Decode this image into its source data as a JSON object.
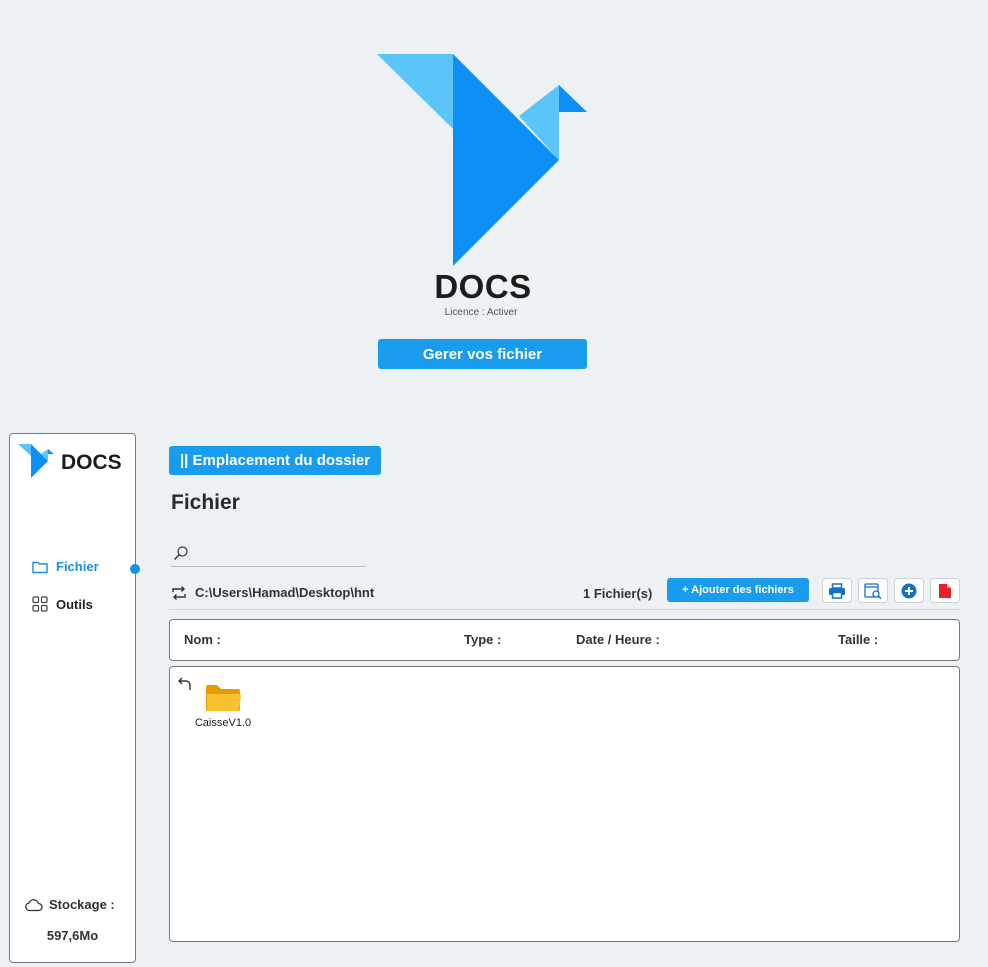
{
  "app": {
    "title": "DOCS",
    "licence": "Licence : Activer",
    "manage_button": "Gerer vos fichier"
  },
  "sidebar": {
    "title": "DOCS",
    "items": [
      {
        "label": "Fichier",
        "icon": "folder-icon",
        "active": true
      },
      {
        "label": "Outils",
        "icon": "grid-icon",
        "active": false
      }
    ],
    "storage_label": "Stockage :",
    "storage_value": "597,6Mo"
  },
  "main": {
    "location_button": "|| Emplacement du dossier",
    "section_title": "Fichier",
    "search": {
      "placeholder": "",
      "value": ""
    },
    "path": "C:\\Users\\Hamad\\Desktop\\hnt",
    "file_count": "1  Fichier(s)",
    "add_button": "+ Ajouter des fichiers",
    "toolbar": [
      "print-icon",
      "view-icon",
      "add-circle-icon",
      "pdf-icon"
    ],
    "columns": [
      "Nom :",
      "Type :",
      "Date / Heure :",
      "Taille :"
    ],
    "files": [
      {
        "name": "CaisseV1.0",
        "icon": "folder-icon"
      }
    ]
  },
  "colors": {
    "accent": "#1a9cee",
    "logo_dark": "#0e8ff5",
    "logo_light": "#5bc4f8",
    "folder": "#f7b500"
  }
}
